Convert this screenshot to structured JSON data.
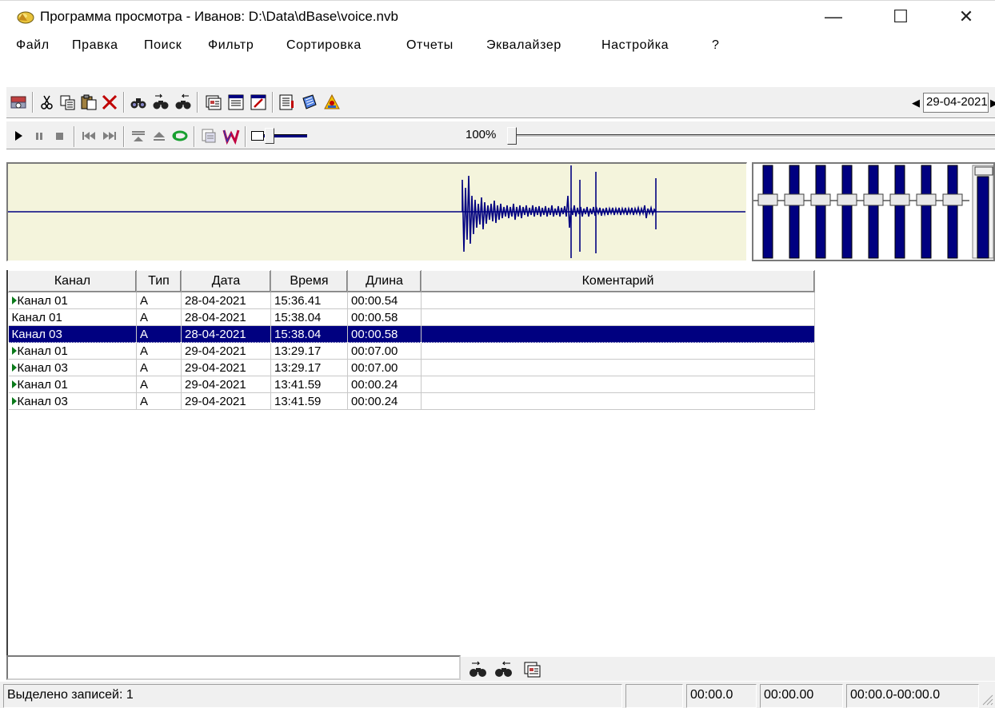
{
  "window": {
    "title": "Программа просмотра - Иванов: D:\\Data\\dBase\\voice.nvb",
    "minimize_glyph": "—",
    "maximize_glyph": "☐",
    "close_glyph": "✕"
  },
  "menu": [
    "Файл",
    "Правка",
    "Поиск",
    "Фильтр",
    "Сортировка",
    "Отчеты",
    "Эквалайзер",
    "Настройка",
    "?"
  ],
  "toolbar": {
    "date": "29-04-2021",
    "icons": [
      "db-properties-icon",
      "cut-icon",
      "copy-icon",
      "paste-icon",
      "delete-icon",
      "find-icon",
      "find-next-icon",
      "find-prev-icon",
      "card-icon",
      "list-icon",
      "edit-icon",
      "report-icon",
      "notes-icon",
      "warning-icon"
    ]
  },
  "player": {
    "volume_percent_label": "100%",
    "volume_level": 1.0,
    "speed_level": 0.3
  },
  "equalizer": {
    "bands": 8
  },
  "table": {
    "columns": [
      "Канал",
      "Тип",
      "Дата",
      "Время",
      "Длина",
      "Коментарий"
    ],
    "rows": [
      {
        "channel": "Канал 01",
        "type": "A",
        "date": "28-04-2021",
        "time": "15:36.41",
        "length": "00:00.54",
        "comment": "",
        "marked": true,
        "selected": false
      },
      {
        "channel": "Канал 01",
        "type": "A",
        "date": "28-04-2021",
        "time": "15:38.04",
        "length": "00:00.58",
        "comment": "",
        "marked": false,
        "selected": false
      },
      {
        "channel": "Канал 03",
        "type": "A",
        "date": "28-04-2021",
        "time": "15:38.04",
        "length": "00:00.58",
        "comment": "",
        "marked": false,
        "selected": true
      },
      {
        "channel": "Канал 01",
        "type": "A",
        "date": "29-04-2021",
        "time": "13:29.17",
        "length": "00:07.00",
        "comment": "",
        "marked": true,
        "selected": false
      },
      {
        "channel": "Канал 03",
        "type": "A",
        "date": "29-04-2021",
        "time": "13:29.17",
        "length": "00:07.00",
        "comment": "",
        "marked": true,
        "selected": false
      },
      {
        "channel": "Канал 01",
        "type": "A",
        "date": "29-04-2021",
        "time": "13:41.59",
        "length": "00:00.24",
        "comment": "",
        "marked": true,
        "selected": false
      },
      {
        "channel": "Канал 03",
        "type": "A",
        "date": "29-04-2021",
        "time": "13:41.59",
        "length": "00:00.24",
        "comment": "",
        "marked": true,
        "selected": false
      }
    ]
  },
  "search": {
    "value": ""
  },
  "status": {
    "selected": "Выделено записей: 1",
    "pane2": "",
    "pos": "00:00.0",
    "len": "00:00.00",
    "range": "00:00.0-00:00.0"
  },
  "colors": {
    "selection": "#000080",
    "wave": "#000080",
    "wave_bg": "#f4f4dc",
    "marker": "#0a7a1a"
  }
}
